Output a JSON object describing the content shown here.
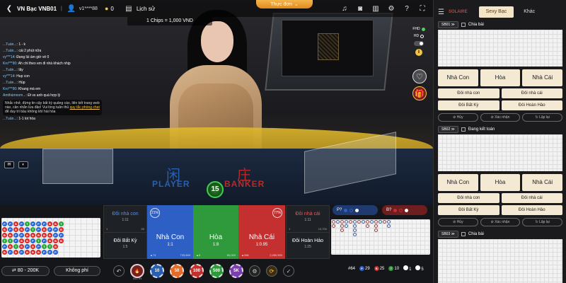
{
  "topbar": {
    "table_name": "VN Bạc VNB01",
    "username": "v1****88",
    "balance": "0",
    "history_label": "Lịch sử",
    "menu_label": "Thực đơn"
  },
  "chips_info": "1 Chips = 1,000 VND",
  "quality": {
    "fhd": "FHD",
    "hd": "HD"
  },
  "chat": {
    "messages": [
      {
        "name": "...Tuấn...",
        "text": "1 - k"
      },
      {
        "name": "...Tuấn...",
        "text": "cái 2 phút nữa"
      },
      {
        "name": "vy***14",
        "text": "Đang lúi ám giờ về 0"
      },
      {
        "name": "Kro***90",
        "text": "Ah chỉ theo em đi nhà khách nhịp"
      },
      {
        "name": "...Tuấn...",
        "text": "lây"
      },
      {
        "name": "vy***14",
        "text": "Hup con"
      },
      {
        "name": "...Tuấn...",
        "text": "Húp"
      },
      {
        "name": "Kro***90",
        "text": "Khang mà em"
      },
      {
        "name": "Ámthámnom...",
        "text": "Đi vs anh quá hợp lý"
      }
    ],
    "system_notice": "Nhắc nhở, đừng tin cậy bất kỳ quảng cáo, liên kết trang web nào, cần nhắn lừa đảo! Vui lòng tuân thủ",
    "system_link": "quy tắc phòng chat",
    "system_tail": "để duy trì bầu không khí hài hòa",
    "last": {
      "name": "...Tuấn...",
      "text": "1-1 lot hòa"
    }
  },
  "dealer": {
    "player_cn": "闲",
    "banker_cn": "庄",
    "player_en": "PLAYER",
    "banker_en": "BANKER",
    "countdown": "15"
  },
  "bets": {
    "player_pair": {
      "label": "Đôi nhà con",
      "odds": "1:11",
      "left_count": "1",
      "right_amount": "50"
    },
    "either_pair": {
      "label": "Đôi Bất Kỳ",
      "odds": "1:5"
    },
    "player": {
      "label": "Nhà Con",
      "odds": "1:1",
      "pct": "21%",
      "count": "74",
      "amount": "733,600"
    },
    "tie": {
      "label": "Hòa",
      "odds": "1:8",
      "count": "8",
      "amount": "60,000"
    },
    "banker": {
      "label": "Nhà Cái",
      "odds": "1:0.95",
      "pct": "77%",
      "count": "266",
      "amount": "2,450,500"
    },
    "banker_pair": {
      "label": "Đôi nhà cái",
      "odds": "1:11",
      "left_count": "1",
      "right_amount": "13,700"
    },
    "perfect_pair": {
      "label": "Đôi Hoàn Hảo",
      "odds": "1:25"
    }
  },
  "predict": {
    "player": "P?",
    "banker": "B?"
  },
  "footer": {
    "bet_limit": "80 - 200K",
    "no_fee": "Không phí",
    "all_in": "ALL IN",
    "chips": [
      "10",
      "50",
      "100",
      "500",
      "5K"
    ],
    "stats": {
      "round": "#64",
      "p": "29",
      "b": "25",
      "t": "10",
      "p_badge": "P",
      "b_badge": "B",
      "t_badge": "T",
      "pp": "1",
      "bp": "5"
    }
  },
  "lobby": {
    "brand": "SOLAIRE",
    "tab_active": "Sexy Bạc",
    "tab_other": "Khác",
    "tables": [
      {
        "id": "SB01",
        "status": "Chia bài",
        "player": "Nhà Con",
        "tie": "Hòa",
        "banker": "Nhà Cái",
        "pp": "Đôi nhà con",
        "bp": "Đôi nhà cái",
        "ap": "Đôi Bất Kỳ",
        "perf": "Đôi Hoàn Hảo",
        "cancel": "Hủy",
        "confirm": "Xác nhận",
        "repeat": "Lặp lại"
      },
      {
        "id": "SB02",
        "status": "Đang kết toán",
        "player": "Nhà Con",
        "tie": "Hòa",
        "banker": "Nhà Cái",
        "pp": "Đôi nhà con",
        "bp": "Đôi nhà cái",
        "ap": "Đôi Bất Kỳ",
        "perf": "Đôi Hoàn Hảo",
        "cancel": "Hủy",
        "confirm": "Xác nhận",
        "repeat": "Lặp lại"
      },
      {
        "id": "SB03",
        "status": "Chia bài"
      }
    ]
  },
  "colors": {
    "player": "#2d5fc4",
    "banker": "#c43030",
    "tie": "#2f9a3c",
    "accent": "#f2a33a"
  }
}
